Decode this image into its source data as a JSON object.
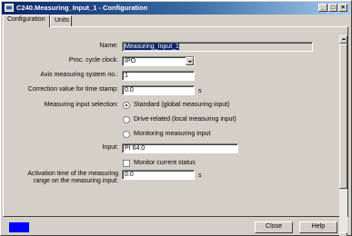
{
  "window": {
    "title": "C240.Measuring_Input_1 - Configuration",
    "minimize": "_",
    "maximize": "□",
    "close": "×"
  },
  "tabs": [
    {
      "label": "Configuration",
      "active": true
    },
    {
      "label": "Units",
      "active": false
    }
  ],
  "form": {
    "name_label": "Name:",
    "name_value": "Measuring_Input_1",
    "proc_cycle_label": "Proc. cycle clock:",
    "proc_cycle_value": "IPO",
    "axis_label": "Axis measuring system no.:",
    "axis_value": "1",
    "correction_label": "Correction value for time stamp:",
    "correction_value": "0.0",
    "correction_unit": "s",
    "selection_label": "Measuring input selection:",
    "options": [
      {
        "label": "Standard (global measuring input)",
        "selected": true
      },
      {
        "label": "Drive-related (local measuring input)",
        "selected": false
      },
      {
        "label": "Monitoring measuring input",
        "selected": false
      }
    ],
    "input_label": "Input:",
    "input_value": "PI 64.0",
    "monitor_label": "Monitor current status",
    "monitor_checked": false,
    "activation_label_1": "Activation time of the measuring",
    "activation_label_2": "range on the measuring input:",
    "activation_value": "0.0",
    "activation_unit": "s"
  },
  "buttons": {
    "close": "Close",
    "help": "Help"
  },
  "colors": {
    "titlebar": "#0a246a",
    "status_block": "#0000ff"
  }
}
